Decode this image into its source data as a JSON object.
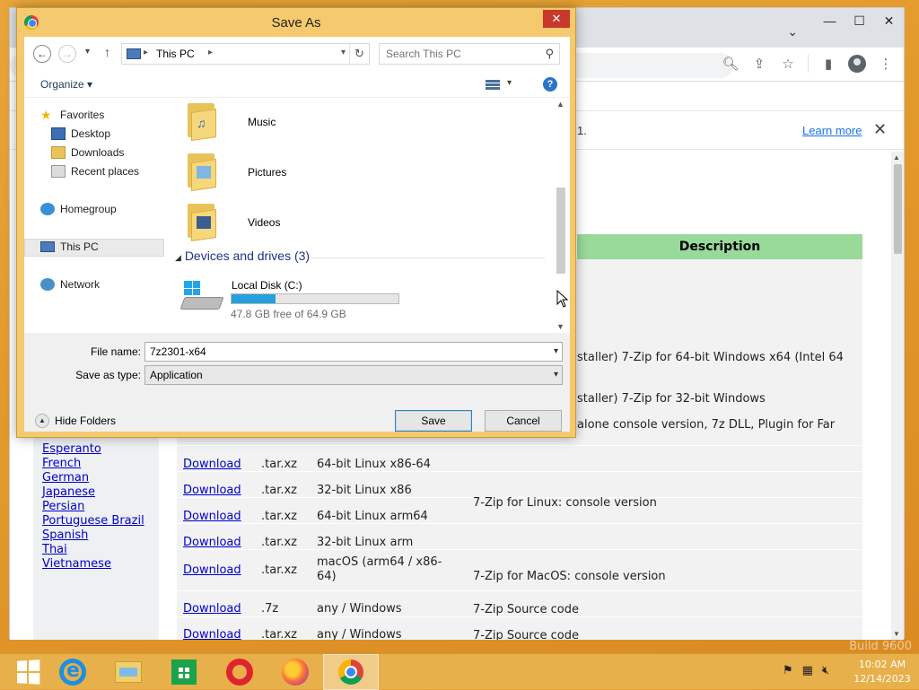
{
  "desktop": {
    "watermark": "Build 9600"
  },
  "browser": {
    "infobar": {
      "text": "1.",
      "learn_more": "Learn more"
    },
    "table": {
      "description_header": "Description",
      "partial_rows": [
        "stalle​r) 7-Zip for 64-bit Windows x64 (Intel 64",
        "stalle​r) 7-Zip for 32-bit Windows",
        "alone console version, 7z DLL, Plugin for Far"
      ],
      "rows": [
        {
          "link": "Download",
          "type": ".tar.xz",
          "system": "64-bit Linux x86-64"
        },
        {
          "link": "Download",
          "type": ".tar.xz",
          "system": "32-bit Linux x86"
        },
        {
          "link": "Download",
          "type": ".tar.xz",
          "system": "64-bit Linux arm64"
        },
        {
          "link": "Download",
          "type": ".tar.xz",
          "system": "32-bit Linux arm"
        },
        {
          "link": "Download",
          "type": ".tar.xz",
          "system": "macOS (arm64 / x86-64)"
        },
        {
          "link": "Download",
          "type": ".7z",
          "system": "any / Windows"
        },
        {
          "link": "Download",
          "type": ".tar.xz",
          "system": "any / Windows"
        }
      ],
      "descriptions": {
        "linux": "7-Zip for Linux: console version",
        "macos": "7-Zip for MacOS: console version",
        "source1": "7-Zip Source code",
        "source2": "7-Zip Source code"
      }
    },
    "languages": [
      "Esperanto",
      "French",
      "German",
      "Japanese",
      "Persian",
      "Portuguese Brazil",
      "Spanish",
      "Thai",
      "Vietnamese"
    ]
  },
  "dialog": {
    "title": "Save As",
    "close": "✕",
    "breadcrumb": "This PC",
    "search_placeholder": "Search This PC",
    "organize": "Organize",
    "organize_arrow": "▾",
    "nav": {
      "favorites": "Favorites",
      "desktop": "Desktop",
      "downloads": "Downloads",
      "recent": "Recent places",
      "homegroup": "Homegroup",
      "this_pc": "This PC",
      "network": "Network"
    },
    "folders": [
      "Music",
      "Pictures",
      "Videos"
    ],
    "devices_header": "Devices and drives (3)",
    "drive": {
      "name": "Local Disk (C:)",
      "free": "47.8 GB free of 64.9 GB",
      "used_fraction": 0.264
    },
    "file_name_label": "File name:",
    "file_name": "7z2301-x64",
    "save_type_label": "Save as type:",
    "save_type": "Application",
    "hide_folders": "Hide Folders",
    "save": "Save",
    "cancel": "Cancel"
  },
  "taskbar": {
    "time": "10:02 AM",
    "date": "12/14/2023"
  }
}
